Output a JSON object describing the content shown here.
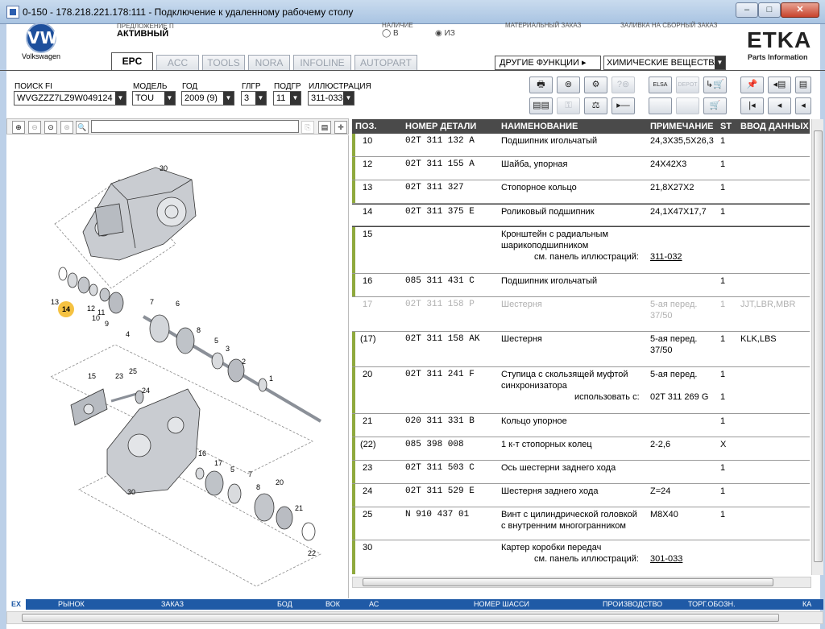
{
  "window": {
    "title": "0-150 - 178.218.221.178:111 - Подключение к удаленному рабочему столу",
    "min": "–",
    "max": "□",
    "close": "✕"
  },
  "header": {
    "logo_text": "VW",
    "brand": "Volkswagen",
    "pred_label": "ПРЕДЛОЖЕНИЕ П",
    "pred_value": "АКТИВНЫЙ",
    "nalich_label": "НАЛИЧИЕ",
    "opt_v": "◯ В",
    "opt_iz": "◉ ИЗ",
    "mat_label": "МАТЕРИАЛЬНЫЙ ЗАКАЗ",
    "zal_label": "ЗАЛИВКА НА СБОРНЫЙ ЗАКАЗ",
    "etka": "ETKA",
    "etka_sub": "Parts Information"
  },
  "tabs": [
    "EPC",
    "ACC",
    "TOOLS",
    "NORA",
    "INFOLINE",
    "AUTOPART"
  ],
  "other_functions": "ДРУГИЕ ФУНКЦИИ ▸",
  "chem_select": "ХИМИЧЕСКИЕ ВЕЩЕСТВА",
  "fields": {
    "poisk_label": "ПОИСК FI",
    "poisk_value": "WVGZZZ7LZ9W049124",
    "model_label": "МОДЕЛЬ",
    "model_value": "TOU",
    "god_label": "ГОД",
    "god_value": "2009 (9)",
    "glgr_label": "ГЛГР",
    "glgr_value": "3",
    "podgr_label": "ПОДГР",
    "podgr_value": "11",
    "illus_label": "ИЛЛЮСТРАЦИЯ",
    "illus_value": "311-033"
  },
  "toolbar": {
    "row1": [
      "🖶",
      "⊚",
      "⚙",
      "?⊚",
      "ELSA",
      "DEPOT",
      "↳🛒",
      "📌",
      "◂▤",
      "▤"
    ],
    "row2": [
      "▤▤",
      "⚿",
      "⚖",
      "▸—",
      "",
      "",
      "🛒",
      "|◂",
      "◂",
      "◂"
    ]
  },
  "left_tools": [
    "⊕",
    "⊖",
    "⊙",
    "⊛",
    "🔍"
  ],
  "callouts": [
    "30",
    "13",
    "14",
    "12",
    "11",
    "10",
    "9",
    "4",
    "7",
    "6",
    "8",
    "5",
    "3",
    "2",
    "1",
    "15",
    "23",
    "25",
    "24",
    "16",
    "17",
    "5",
    "7",
    "8",
    "20",
    "21",
    "22",
    "30"
  ],
  "table": {
    "headers": [
      "ПОЗ.",
      "НОМЕР ДЕТАЛИ",
      "НАИМЕНОВАНИЕ",
      "ПРИМЕЧАНИЕ",
      "ST",
      "ВВОД ДАННЫХ ПО МОДЕЛИ"
    ],
    "rows": [
      {
        "pos": "10",
        "part": "02T  311  132  A",
        "name": "Подшипник игольчатый",
        "note": "24,3X35,5X26,3",
        "st": "1",
        "model": ""
      },
      {
        "pos": "12",
        "part": "02T  311  155  A",
        "name": "Шайба, упорная",
        "note": "24X42X3",
        "st": "1",
        "model": ""
      },
      {
        "pos": "13",
        "part": "02T  311  327",
        "name": "Стопорное кольцо",
        "note": "21,8X27X2",
        "st": "1",
        "model": ""
      },
      {
        "pos": "14",
        "part": "02T  311  375  E",
        "name": "Роликовый подшипник",
        "note": "24,1X47X17,7",
        "st": "1",
        "model": ""
      },
      {
        "pos": "15",
        "part": "",
        "name": "Кронштейн с  радиальным",
        "name2": "шарикоподшипником",
        "name3": "см. панель иллюстраций:",
        "link": "311-032",
        "note": "",
        "st": "",
        "model": ""
      },
      {
        "pos": "16",
        "part": "085  311  431  C",
        "name": "Подшипник игольчатый",
        "note": "",
        "st": "1",
        "model": ""
      },
      {
        "pos": "17",
        "part": "02T  311  158  P",
        "name": "Шестерня",
        "note": "5-ая перед.",
        "note2": "37/50",
        "st": "1",
        "model": "JJT,LBR,MBR"
      },
      {
        "pos": "(17)",
        "part": "02T  311  158  AK",
        "name": "Шестерня",
        "note": "5-ая перед.",
        "note2": "37/50",
        "st": "1",
        "model": "KLK,LBS"
      },
      {
        "pos": "20",
        "part": "02T  311  241  F",
        "name": "Ступица с скользящей муфтой",
        "name2": "синхронизатора",
        "name3": "использовать с:",
        "link": "02T 311 269 G",
        "note": "5-ая перед.",
        "st": "1",
        "st2": "1",
        "model": ""
      },
      {
        "pos": "21",
        "part": "020  311  331  B",
        "name": "Кольцо упорное",
        "note": "",
        "st": "1",
        "model": ""
      },
      {
        "pos": "(22)",
        "part": "085  398  008",
        "name": "1 к-т стопорных колец",
        "note": "2-2,6",
        "st": "X",
        "model": ""
      },
      {
        "pos": "23",
        "part": "02T  311  503  C",
        "name": "Ось шестерни заднего хода",
        "note": "",
        "st": "1",
        "model": ""
      },
      {
        "pos": "24",
        "part": "02T  311  529  E",
        "name": "Шестерня заднего хода",
        "note": "Z=24",
        "st": "1",
        "model": ""
      },
      {
        "pos": "25",
        "part": "N     910  437  01",
        "name": "Винт с цилиндрической головкой",
        "name2": "с внутренним многогранником",
        "note": "M8X40",
        "st": "1",
        "model": ""
      },
      {
        "pos": "30",
        "part": "",
        "name": "Картер коробки передач",
        "name3": "см. панель иллюстраций:",
        "link": "301-033",
        "note": "",
        "st": "",
        "model": ""
      }
    ]
  },
  "statusbar": {
    "corner": "EX",
    "items": [
      "РЫНОК",
      "ЗАКАЗ",
      "БОД",
      "ВОК",
      "АС",
      "НОМЕР ШАССИ",
      "ПРОИЗВОДСТВО",
      "ТОРГ.ОБОЗН.",
      "КА"
    ]
  },
  "colors": {
    "accent_bar": "#8fa93d",
    "status_bar": "#1f5aa6",
    "callout_highlight": "#f5c242"
  }
}
